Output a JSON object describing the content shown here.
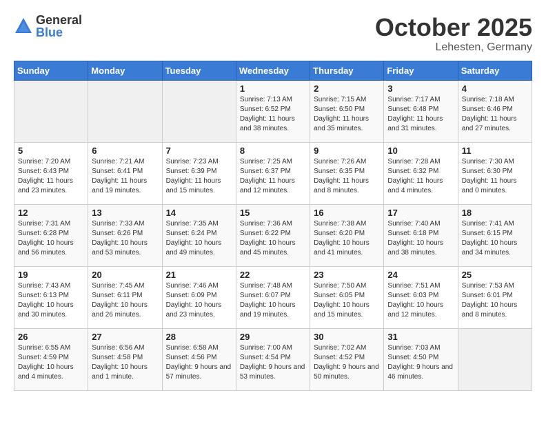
{
  "logo": {
    "general": "General",
    "blue": "Blue"
  },
  "header": {
    "month": "October 2025",
    "location": "Lehesten, Germany"
  },
  "weekdays": [
    "Sunday",
    "Monday",
    "Tuesday",
    "Wednesday",
    "Thursday",
    "Friday",
    "Saturday"
  ],
  "weeks": [
    [
      {
        "day": "",
        "sunrise": "",
        "sunset": "",
        "daylight": ""
      },
      {
        "day": "",
        "sunrise": "",
        "sunset": "",
        "daylight": ""
      },
      {
        "day": "",
        "sunrise": "",
        "sunset": "",
        "daylight": ""
      },
      {
        "day": "1",
        "sunrise": "Sunrise: 7:13 AM",
        "sunset": "Sunset: 6:52 PM",
        "daylight": "Daylight: 11 hours and 38 minutes."
      },
      {
        "day": "2",
        "sunrise": "Sunrise: 7:15 AM",
        "sunset": "Sunset: 6:50 PM",
        "daylight": "Daylight: 11 hours and 35 minutes."
      },
      {
        "day": "3",
        "sunrise": "Sunrise: 7:17 AM",
        "sunset": "Sunset: 6:48 PM",
        "daylight": "Daylight: 11 hours and 31 minutes."
      },
      {
        "day": "4",
        "sunrise": "Sunrise: 7:18 AM",
        "sunset": "Sunset: 6:46 PM",
        "daylight": "Daylight: 11 hours and 27 minutes."
      }
    ],
    [
      {
        "day": "5",
        "sunrise": "Sunrise: 7:20 AM",
        "sunset": "Sunset: 6:43 PM",
        "daylight": "Daylight: 11 hours and 23 minutes."
      },
      {
        "day": "6",
        "sunrise": "Sunrise: 7:21 AM",
        "sunset": "Sunset: 6:41 PM",
        "daylight": "Daylight: 11 hours and 19 minutes."
      },
      {
        "day": "7",
        "sunrise": "Sunrise: 7:23 AM",
        "sunset": "Sunset: 6:39 PM",
        "daylight": "Daylight: 11 hours and 15 minutes."
      },
      {
        "day": "8",
        "sunrise": "Sunrise: 7:25 AM",
        "sunset": "Sunset: 6:37 PM",
        "daylight": "Daylight: 11 hours and 12 minutes."
      },
      {
        "day": "9",
        "sunrise": "Sunrise: 7:26 AM",
        "sunset": "Sunset: 6:35 PM",
        "daylight": "Daylight: 11 hours and 8 minutes."
      },
      {
        "day": "10",
        "sunrise": "Sunrise: 7:28 AM",
        "sunset": "Sunset: 6:32 PM",
        "daylight": "Daylight: 11 hours and 4 minutes."
      },
      {
        "day": "11",
        "sunrise": "Sunrise: 7:30 AM",
        "sunset": "Sunset: 6:30 PM",
        "daylight": "Daylight: 11 hours and 0 minutes."
      }
    ],
    [
      {
        "day": "12",
        "sunrise": "Sunrise: 7:31 AM",
        "sunset": "Sunset: 6:28 PM",
        "daylight": "Daylight: 10 hours and 56 minutes."
      },
      {
        "day": "13",
        "sunrise": "Sunrise: 7:33 AM",
        "sunset": "Sunset: 6:26 PM",
        "daylight": "Daylight: 10 hours and 53 minutes."
      },
      {
        "day": "14",
        "sunrise": "Sunrise: 7:35 AM",
        "sunset": "Sunset: 6:24 PM",
        "daylight": "Daylight: 10 hours and 49 minutes."
      },
      {
        "day": "15",
        "sunrise": "Sunrise: 7:36 AM",
        "sunset": "Sunset: 6:22 PM",
        "daylight": "Daylight: 10 hours and 45 minutes."
      },
      {
        "day": "16",
        "sunrise": "Sunrise: 7:38 AM",
        "sunset": "Sunset: 6:20 PM",
        "daylight": "Daylight: 10 hours and 41 minutes."
      },
      {
        "day": "17",
        "sunrise": "Sunrise: 7:40 AM",
        "sunset": "Sunset: 6:18 PM",
        "daylight": "Daylight: 10 hours and 38 minutes."
      },
      {
        "day": "18",
        "sunrise": "Sunrise: 7:41 AM",
        "sunset": "Sunset: 6:15 PM",
        "daylight": "Daylight: 10 hours and 34 minutes."
      }
    ],
    [
      {
        "day": "19",
        "sunrise": "Sunrise: 7:43 AM",
        "sunset": "Sunset: 6:13 PM",
        "daylight": "Daylight: 10 hours and 30 minutes."
      },
      {
        "day": "20",
        "sunrise": "Sunrise: 7:45 AM",
        "sunset": "Sunset: 6:11 PM",
        "daylight": "Daylight: 10 hours and 26 minutes."
      },
      {
        "day": "21",
        "sunrise": "Sunrise: 7:46 AM",
        "sunset": "Sunset: 6:09 PM",
        "daylight": "Daylight: 10 hours and 23 minutes."
      },
      {
        "day": "22",
        "sunrise": "Sunrise: 7:48 AM",
        "sunset": "Sunset: 6:07 PM",
        "daylight": "Daylight: 10 hours and 19 minutes."
      },
      {
        "day": "23",
        "sunrise": "Sunrise: 7:50 AM",
        "sunset": "Sunset: 6:05 PM",
        "daylight": "Daylight: 10 hours and 15 minutes."
      },
      {
        "day": "24",
        "sunrise": "Sunrise: 7:51 AM",
        "sunset": "Sunset: 6:03 PM",
        "daylight": "Daylight: 10 hours and 12 minutes."
      },
      {
        "day": "25",
        "sunrise": "Sunrise: 7:53 AM",
        "sunset": "Sunset: 6:01 PM",
        "daylight": "Daylight: 10 hours and 8 minutes."
      }
    ],
    [
      {
        "day": "26",
        "sunrise": "Sunrise: 6:55 AM",
        "sunset": "Sunset: 4:59 PM",
        "daylight": "Daylight: 10 hours and 4 minutes."
      },
      {
        "day": "27",
        "sunrise": "Sunrise: 6:56 AM",
        "sunset": "Sunset: 4:58 PM",
        "daylight": "Daylight: 10 hours and 1 minute."
      },
      {
        "day": "28",
        "sunrise": "Sunrise: 6:58 AM",
        "sunset": "Sunset: 4:56 PM",
        "daylight": "Daylight: 9 hours and 57 minutes."
      },
      {
        "day": "29",
        "sunrise": "Sunrise: 7:00 AM",
        "sunset": "Sunset: 4:54 PM",
        "daylight": "Daylight: 9 hours and 53 minutes."
      },
      {
        "day": "30",
        "sunrise": "Sunrise: 7:02 AM",
        "sunset": "Sunset: 4:52 PM",
        "daylight": "Daylight: 9 hours and 50 minutes."
      },
      {
        "day": "31",
        "sunrise": "Sunrise: 7:03 AM",
        "sunset": "Sunset: 4:50 PM",
        "daylight": "Daylight: 9 hours and 46 minutes."
      },
      {
        "day": "",
        "sunrise": "",
        "sunset": "",
        "daylight": ""
      }
    ]
  ]
}
